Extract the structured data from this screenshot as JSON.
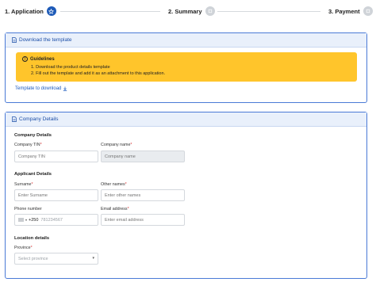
{
  "stepper": {
    "steps": [
      {
        "label": "1. Application",
        "status": "active"
      },
      {
        "label": "2. Summary",
        "status": "inactive"
      },
      {
        "label": "3. Payment",
        "status": "inactive"
      }
    ]
  },
  "download_panel": {
    "title": "Download the template",
    "guidelines": {
      "title": "Guidelines",
      "items": [
        "1. Download the product details template",
        "2. Fill out the template and add it as an attachment to this application."
      ]
    },
    "template_link": "Template to download"
  },
  "company_panel": {
    "title": "Company Details",
    "company_section": {
      "title": "Company Details",
      "tin_label": "Company TIN",
      "tin_placeholder": "Company TIN",
      "name_label": "Company name",
      "name_placeholder": "Company name"
    },
    "applicant_section": {
      "title": "Applicant Details",
      "surname_label": "Surname",
      "surname_placeholder": "Enter Surname",
      "other_names_label": "Other names",
      "other_names_placeholder": "Enter other names",
      "phone_label": "Phone number",
      "phone_code": "+250",
      "phone_placeholder": "781234567",
      "email_label": "Email address",
      "email_placeholder": "Enter email address"
    },
    "location_section": {
      "title": "Location details",
      "province_label": "Province",
      "province_placeholder": "Select province"
    }
  },
  "colors": {
    "accent": "#1e5bb8",
    "warning": "#ffc52b",
    "required": "#dd3333"
  }
}
